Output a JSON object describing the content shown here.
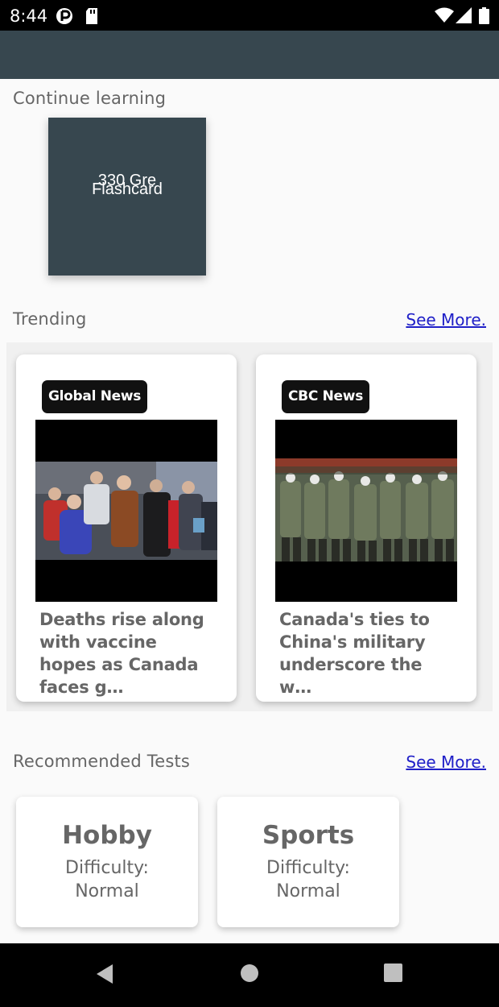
{
  "status_bar": {
    "time": "8:44",
    "icons": [
      "carrier-icon",
      "sd-card-icon",
      "wifi-icon",
      "signal-icon",
      "battery-icon"
    ]
  },
  "continue_learning": {
    "title": "Continue learning",
    "card_line1": "330 Gre",
    "card_line2": "Flashcard"
  },
  "trending": {
    "title": "Trending",
    "see_more": "See More.",
    "items": [
      {
        "source": "Global News",
        "headline": "Deaths rise along with vaccine hopes as Canada faces g…"
      },
      {
        "source": "CBC News",
        "headline": "Canada's ties to China's military underscore the w…"
      }
    ]
  },
  "recommended_tests": {
    "title": "Recommended Tests",
    "see_more": "See More.",
    "items": [
      {
        "name": "Hobby",
        "difficulty_label": "Difficulty:",
        "difficulty": "Normal"
      },
      {
        "name": "Sports",
        "difficulty_label": "Difficulty:",
        "difficulty": "Normal"
      }
    ]
  },
  "nav_bar": {
    "buttons": [
      "back-icon",
      "home-icon",
      "recents-icon"
    ]
  },
  "colors": {
    "app_bar": "#37474f",
    "link": "#2020c8",
    "text_muted": "#666666"
  }
}
